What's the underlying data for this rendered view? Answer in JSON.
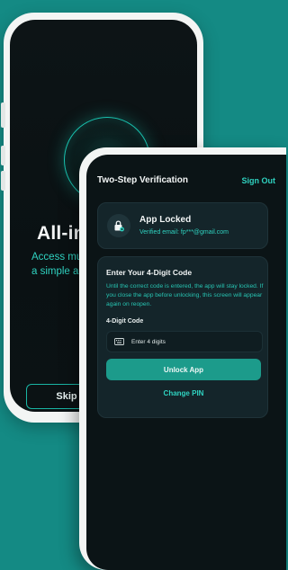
{
  "back_screen": {
    "title": "All-in-C",
    "description_lines": [
      "Access multipl",
      "a simple and s"
    ],
    "skip_label": "Skip"
  },
  "front_screen": {
    "header": {
      "title": "Two-Step Verification",
      "sign_out_label": "Sign Out"
    },
    "lock_card": {
      "title": "App Locked",
      "email_label": "Verified email:",
      "email_value": "fp***@gmail.com"
    },
    "code_card": {
      "title": "Enter Your 4-Digit Code",
      "description_lines": [
        "Until the correct code is entered, the app will stay locked. If",
        "you close the app before unlocking, this screen will appear",
        "again on reopen."
      ],
      "input_label": "4-Digit Code",
      "input_placeholder": "Enter 4 digits",
      "unlock_label": "Unlock App",
      "change_pin_label": "Change PIN"
    }
  },
  "colors": {
    "background": "#148a84",
    "accent": "#2fd2c0",
    "button": "#1c9b8b",
    "screen": "#0b1416"
  },
  "icons": [
    "connected-nodes-icon",
    "lock-icon",
    "keyboard-icon",
    "back-nav-icon"
  ]
}
